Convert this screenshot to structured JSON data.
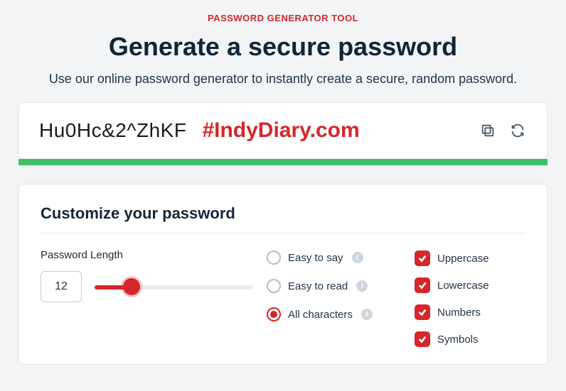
{
  "header": {
    "subtitle": "PASSWORD GENERATOR TOOL",
    "title": "Generate a secure password",
    "description": "Use our online password generator to instantly create a secure, random password."
  },
  "password": {
    "value": "Hu0Hc&2^ZhKF",
    "watermark": "#IndyDiary.com"
  },
  "strength": {
    "color": "#3fc06b"
  },
  "customize": {
    "title": "Customize your password",
    "length_label": "Password Length",
    "length_value": "12",
    "options": {
      "easy_say": "Easy to say",
      "easy_read": "Easy to read",
      "all_chars": "All characters",
      "selected": "all_chars"
    },
    "checks": {
      "uppercase": "Uppercase",
      "lowercase": "Lowercase",
      "numbers": "Numbers",
      "symbols": "Symbols"
    }
  }
}
